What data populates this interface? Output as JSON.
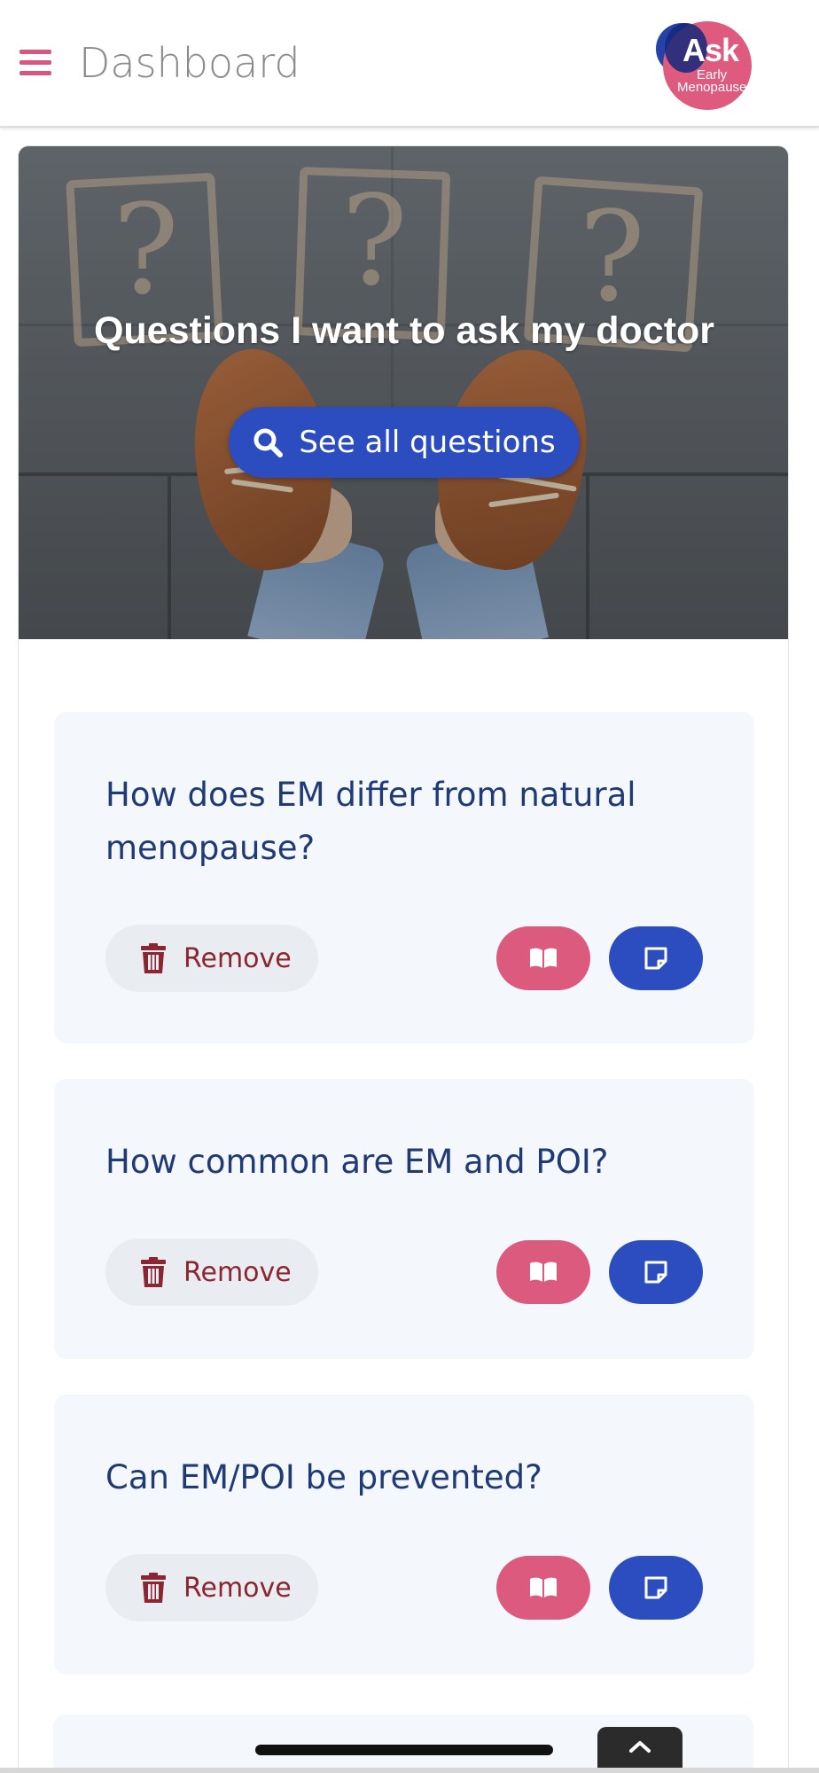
{
  "header": {
    "title": "Dashboard",
    "menu_icon": "hamburger-menu-icon",
    "logo": {
      "word": "Ask",
      "line1": "Early",
      "line2": "Menopause"
    }
  },
  "hero": {
    "title": "Questions I want to ask my doctor",
    "button_label": "See all questions",
    "button_icon": "search-icon"
  },
  "questions": [
    {
      "text": "How does EM differ from natural menopause?",
      "remove_label": "Remove"
    },
    {
      "text": "How common are EM and POI?",
      "remove_label": "Remove"
    },
    {
      "text": "Can EM/POI be prevented?",
      "remove_label": "Remove"
    }
  ],
  "icons": {
    "remove": "trash-icon",
    "read": "book-open-icon",
    "note": "sticky-note-icon",
    "scroll_top": "chevron-up-icon"
  },
  "colors": {
    "accent_pink": "#dc5a7d",
    "primary_blue": "#2c4dbf",
    "question_text": "#1f3a74",
    "remove_red": "#8b2531",
    "card_bg": "#f4f7fb"
  }
}
